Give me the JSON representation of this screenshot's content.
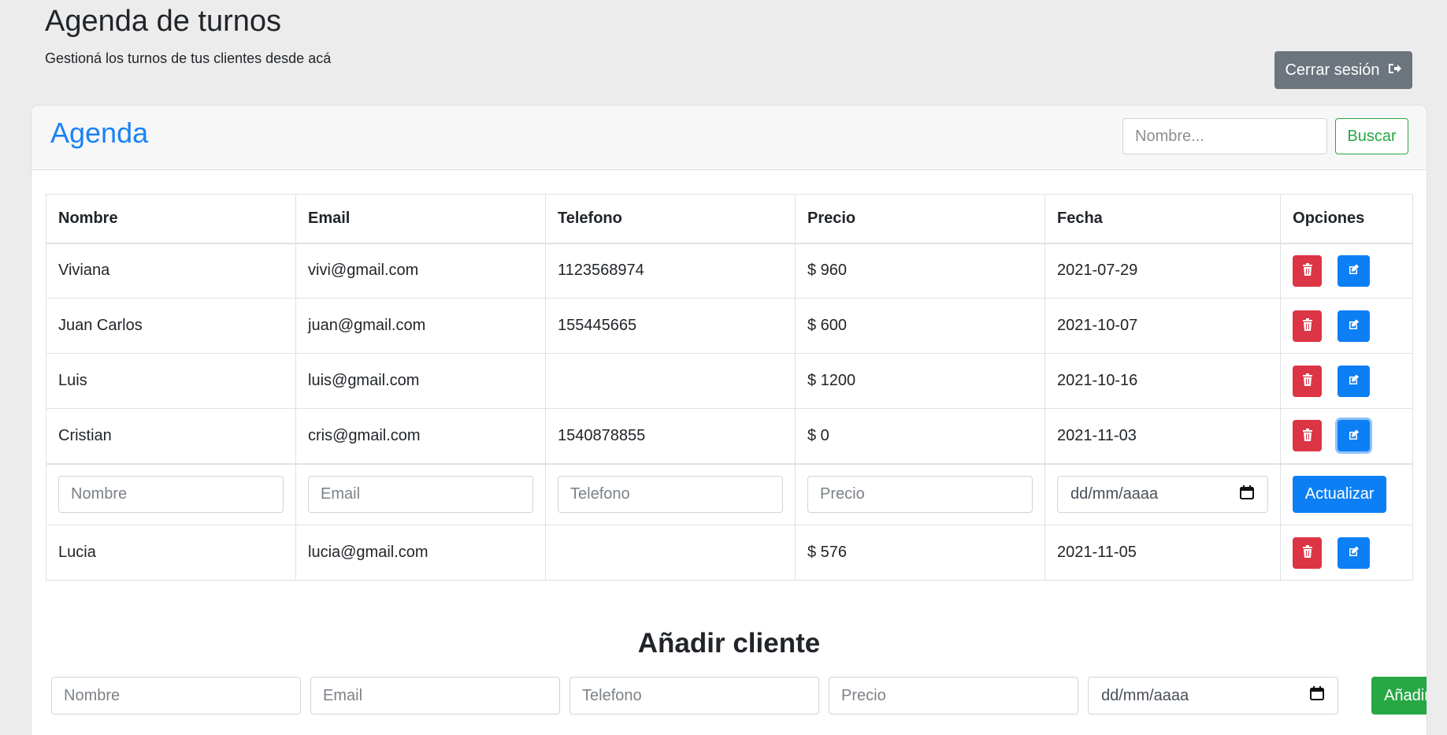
{
  "header": {
    "title": "Agenda de turnos",
    "subtitle": "Gestioná los turnos de tus clientes desde acá",
    "logout_label": "Cerrar sesión"
  },
  "card": {
    "title": "Agenda",
    "search_placeholder": "Nombre...",
    "search_label": "Buscar"
  },
  "table": {
    "columns": [
      "Nombre",
      "Email",
      "Telefono",
      "Precio",
      "Fecha",
      "Opciones"
    ],
    "rows": [
      {
        "nombre": "Viviana",
        "email": "vivi@gmail.com",
        "telefono": "1123568974",
        "precio": "$ 960",
        "fecha": "2021-07-29"
      },
      {
        "nombre": "Juan Carlos",
        "email": "juan@gmail.com",
        "telefono": "155445665",
        "precio": "$ 600",
        "fecha": "2021-10-07"
      },
      {
        "nombre": "Luis",
        "email": "luis@gmail.com",
        "telefono": "",
        "precio": "$ 1200",
        "fecha": "2021-10-16"
      },
      {
        "nombre": "Cristian",
        "email": "cris@gmail.com",
        "telefono": "1540878855",
        "precio": "$ 0",
        "fecha": "2021-11-03"
      }
    ],
    "edit_row": {
      "nombre_placeholder": "Nombre",
      "email_placeholder": "Email",
      "telefono_placeholder": "Telefono",
      "precio_placeholder": "Precio",
      "date_placeholder": "dd/mm/aaaa",
      "update_label": "Actualizar"
    },
    "last_row": {
      "nombre": "Lucia",
      "email": "lucia@gmail.com",
      "telefono": "",
      "precio": "$ 576",
      "fecha": "2021-11-05"
    }
  },
  "add_form": {
    "title": "Añadir cliente",
    "nombre_placeholder": "Nombre",
    "email_placeholder": "Email",
    "telefono_placeholder": "Telefono",
    "precio_placeholder": "Precio",
    "date_placeholder": "dd/mm/aaaa",
    "add_label": "Añadir"
  },
  "icons": {
    "logout": "sign-out-icon",
    "delete": "trash-icon",
    "edit": "edit-icon",
    "calendar": "calendar-icon"
  },
  "colors": {
    "primary": "#0d7ff5",
    "danger": "#dc3545",
    "success": "#28a745",
    "secondary": "#6c757d",
    "title_blue": "#1a82f7"
  }
}
